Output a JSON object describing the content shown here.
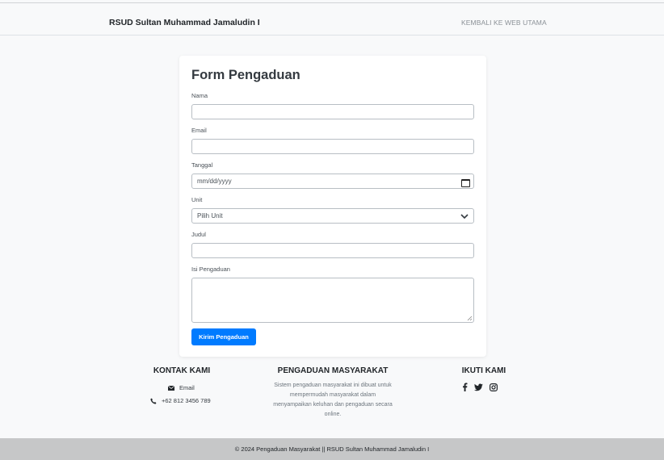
{
  "navbar": {
    "brand": "RSUD Sultan Muhammad Jamaludin I",
    "link": "KEMBALI KE WEB UTAMA"
  },
  "form": {
    "title": "Form Pengaduan",
    "fields": {
      "nama": {
        "label": "Nama",
        "value": ""
      },
      "email": {
        "label": "Email",
        "value": ""
      },
      "tanggal": {
        "label": "Tanggal",
        "placeholder": "mm/dd/yyyy"
      },
      "unit": {
        "label": "Unit",
        "selected": "Pilih Unit"
      },
      "judul": {
        "label": "Judul",
        "value": ""
      },
      "isi": {
        "label": "Isi Pengaduan",
        "value": ""
      }
    },
    "submit_label": "Kirim Pengaduan"
  },
  "footer": {
    "contact": {
      "heading": "KONTAK KAMI",
      "email": "Email",
      "phone": "+62 812 3456 789"
    },
    "about": {
      "heading": "PENGADUAN MASYARAKAT",
      "line1": "Sistem pengaduan masyarakat ini dibuat untuk",
      "line2": "mempermudah masyarakat dalam",
      "line3": "menyampaikan keluhan dan pengaduan secara",
      "line4": "online."
    },
    "social": {
      "heading": "IKUTI KAMI",
      "icons": [
        "facebook-icon",
        "twitter-icon",
        "instagram-icon"
      ]
    }
  },
  "copyright": "© 2024 Pengaduan Masyarakat || RSUD Sultan Muhammad Jamaludin I",
  "colors": {
    "primary": "#007bff",
    "page_bg": "#f8f9fa",
    "bottom_bar": "#c6c7c8"
  }
}
